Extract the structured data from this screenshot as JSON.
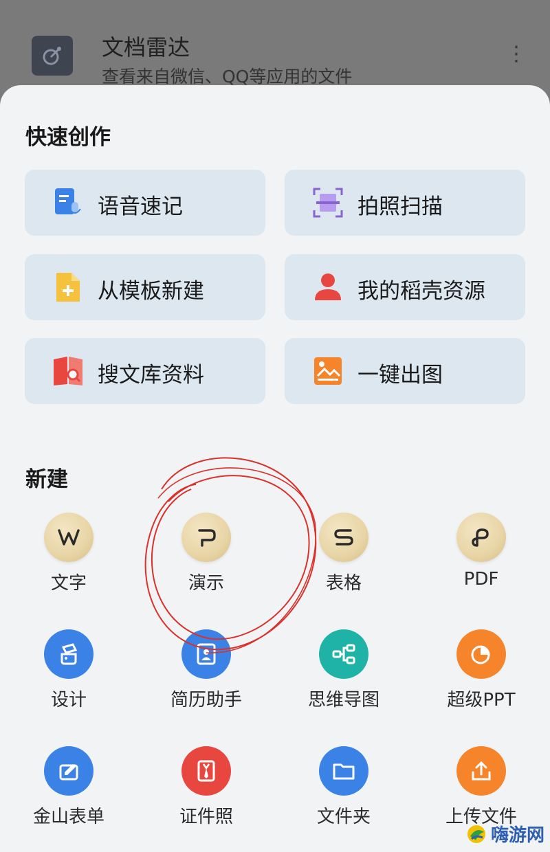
{
  "background_row": {
    "title": "文档雷达",
    "subtitle": "查看来自微信、QQ等应用的文件",
    "more": "⋮"
  },
  "quick_create": {
    "title": "快速创作",
    "cards": [
      {
        "label": "语音速记",
        "icon": "voice-note-icon"
      },
      {
        "label": "拍照扫描",
        "icon": "scan-icon"
      },
      {
        "label": "从模板新建",
        "icon": "template-new-icon"
      },
      {
        "label": "我的稻壳资源",
        "icon": "user-resource-icon"
      },
      {
        "label": "搜文库资料",
        "icon": "library-search-icon"
      },
      {
        "label": "一键出图",
        "icon": "image-generate-icon"
      }
    ]
  },
  "new_section": {
    "title": "新建",
    "items": [
      {
        "label": "文字",
        "glyph": "W",
        "style": "gold"
      },
      {
        "label": "演示",
        "glyph": "P",
        "style": "gold"
      },
      {
        "label": "表格",
        "glyph": "S",
        "style": "gold"
      },
      {
        "label": "PDF",
        "glyph": "P",
        "style": "gold"
      },
      {
        "label": "设计",
        "icon": "design-icon",
        "color": "#3b82e6"
      },
      {
        "label": "简历助手",
        "icon": "resume-icon",
        "color": "#3b82e6"
      },
      {
        "label": "思维导图",
        "icon": "mindmap-icon",
        "color": "#1fb3a8"
      },
      {
        "label": "超级PPT",
        "icon": "super-ppt-icon",
        "color": "#f5842b"
      },
      {
        "label": "金山表单",
        "icon": "form-icon",
        "color": "#3b82e6"
      },
      {
        "label": "证件照",
        "icon": "id-photo-icon",
        "color": "#e8473f"
      },
      {
        "label": "文件夹",
        "icon": "folder-icon",
        "color": "#3b82e6"
      },
      {
        "label": "上传文件",
        "icon": "upload-icon",
        "color": "#f5842b"
      }
    ]
  },
  "watermark": {
    "text": "嗨游网"
  }
}
